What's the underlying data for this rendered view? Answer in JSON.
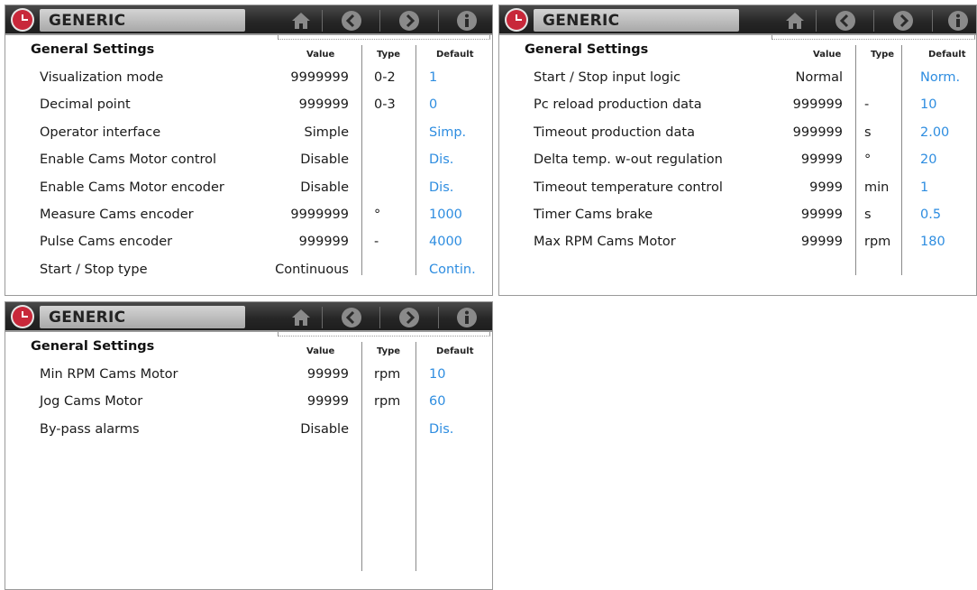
{
  "panels": [
    {
      "title": "GENERIC",
      "section": "General Settings",
      "columns": {
        "value": "Value",
        "type": "Type",
        "default": "Default"
      },
      "rows": [
        {
          "label": "Visualization mode",
          "value": "9999999",
          "type": "0-2",
          "default": "1"
        },
        {
          "label": "Decimal point",
          "value": "999999",
          "type": "0-3",
          "default": "0"
        },
        {
          "label": "Operator interface",
          "value": "Simple",
          "type": "",
          "default": "Simp."
        },
        {
          "label": "Enable Cams Motor control",
          "value": "Disable",
          "type": "",
          "default": "Dis."
        },
        {
          "label": "Enable Cams Motor encoder",
          "value": "Disable",
          "type": "",
          "default": "Dis."
        },
        {
          "label": "Measure Cams encoder",
          "value": "9999999",
          "type": "°",
          "default": "1000"
        },
        {
          "label": "Pulse Cams encoder",
          "value": "999999",
          "type": "-",
          "default": "4000"
        },
        {
          "label": "Start / Stop type",
          "value": "Continuous",
          "type": "",
          "default": "Contin."
        }
      ]
    },
    {
      "title": "GENERIC",
      "section": "General Settings",
      "columns": {
        "value": "Value",
        "type": "Type",
        "default": "Default"
      },
      "rows": [
        {
          "label": "Start / Stop input logic",
          "value": "Normal",
          "type": "",
          "default": "Norm."
        },
        {
          "label": "Pc reload production data",
          "value": "999999",
          "type": "-",
          "default": "10"
        },
        {
          "label": "Timeout production data",
          "value": "999999",
          "type": "s",
          "default": "2.00"
        },
        {
          "label": "Delta temp. w-out regulation",
          "value": "99999",
          "type": "°",
          "default": "20"
        },
        {
          "label": "Timeout temperature control",
          "value": "9999",
          "type": "min",
          "default": "1"
        },
        {
          "label": "Timer Cams brake",
          "value": "99999",
          "type": "s",
          "default": "0.5"
        },
        {
          "label": "Max RPM Cams Motor",
          "value": "99999",
          "type": "rpm",
          "default": "180"
        }
      ]
    },
    {
      "title": "GENERIC",
      "section": "General Settings",
      "columns": {
        "value": "Value",
        "type": "Type",
        "default": "Default"
      },
      "rows": [
        {
          "label": "Min RPM Cams Motor",
          "value": "99999",
          "type": "rpm",
          "default": "10"
        },
        {
          "label": "Jog Cams Motor",
          "value": "99999",
          "type": "rpm",
          "default": "60"
        },
        {
          "label": "By-pass alarms",
          "value": "Disable",
          "type": "",
          "default": "Dis."
        }
      ]
    }
  ],
  "nav_icons": [
    "home-icon",
    "back-icon",
    "forward-icon",
    "info-icon"
  ],
  "colors": {
    "accent": "#2e8de0",
    "logo": "#c8283a",
    "header": "#262626"
  }
}
